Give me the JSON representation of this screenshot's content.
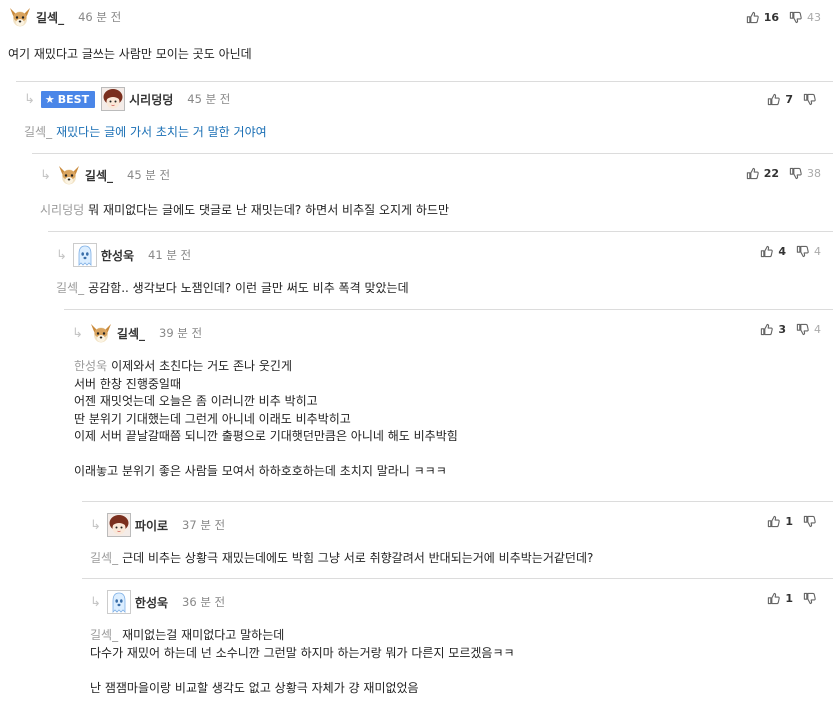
{
  "comments": [
    {
      "author": "길섹_",
      "time": "46 분 전",
      "likes": "16",
      "dislikes": "43",
      "lines": [
        "여기 재밌다고 글쓰는 사람만 모이는 곳도 아닌데"
      ]
    },
    {
      "badge": "BEST",
      "author": "시리덩덩",
      "time": "45 분 전",
      "likes": "7",
      "mention": "길섹_",
      "lines": [
        "재밌다는 글에 가서 초치는 거 말한 거야여"
      ]
    },
    {
      "author": "길섹_",
      "time": "45 분 전",
      "likes": "22",
      "dislikes": "38",
      "mention": "시리덩덩",
      "lines": [
        "뭐 재미없다는 글에도 댓글로 난 재밋는데? 하면서 비추질 오지게 하드만"
      ]
    },
    {
      "author": "한성욱",
      "time": "41 분 전",
      "likes": "4",
      "dislikes": "4",
      "mention": "길섹_",
      "lines": [
        "공감함.. 생각보다 노잼인데? 이런 글만 써도 비추 폭격 맞았는데"
      ]
    },
    {
      "author": "길섹_",
      "time": "39 분 전",
      "likes": "3",
      "dislikes": "4",
      "mention": "한성욱",
      "lines": [
        "이제와서 초친다는 거도 존나 웃긴게",
        "서버 한창 진행중일때",
        "어젠 재밋엇는데 오늘은 좀 이러니깐 비추 박히고",
        "딴 분위기 기대했는데 그런게 아니네 이래도 비추박히고",
        "이제 서버 끝날갈때쯤 되니깐 출평으로 기대햇던만큼은 아니네 해도 비추박힘",
        "",
        "이래놓고 분위기 좋은 사람들 모여서 하하호호하는데 초치지 말라니 ㅋㅋㅋ"
      ]
    },
    {
      "author": "파이로",
      "time": "37 분 전",
      "likes": "1",
      "mention": "길섹_",
      "lines": [
        "근데 비추는 상황극 재밌는데에도 박힘 그냥 서로 취향갈려서 반대되는거에 비추박는거같던데?"
      ]
    },
    {
      "author": "한성욱",
      "time": "36 분 전",
      "likes": "1",
      "mention": "길섹_",
      "lines": [
        "재미없는걸 재미없다고 말하는데",
        "다수가 재밌어 하는데 넌 소수니깐 그런말 하지마 하는거랑 뭐가 다른지 모르겠음ㅋㅋ",
        "",
        "난 잼잼마을이랑 비교할 생각도 없고 상황극 자체가 걍 재미없었음"
      ]
    }
  ],
  "icons": {
    "reply": "reply-arrow-icon",
    "like": "thumbs-up-icon",
    "dislike": "thumbs-down-icon",
    "star": "star-icon"
  },
  "colors": {
    "badge": "#4a86e8",
    "link": "#1a6fb5",
    "muted": "#9a9a9a"
  }
}
